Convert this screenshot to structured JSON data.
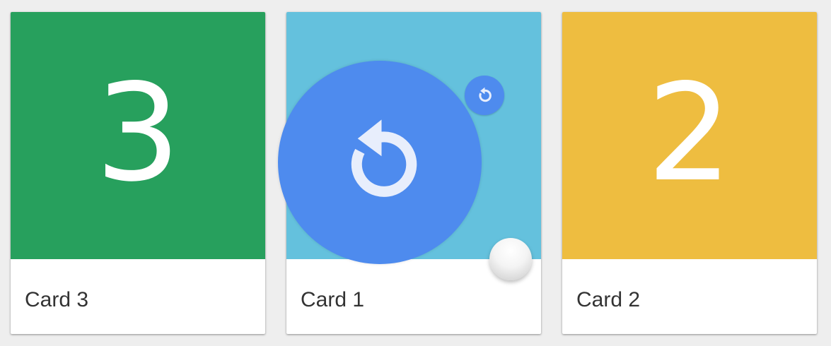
{
  "cards": [
    {
      "id": "card-3",
      "number": "3",
      "label": "Card 3",
      "color": "#27a05d"
    },
    {
      "id": "card-1",
      "number": "",
      "label": "Card 1",
      "color": "#64c1dd"
    },
    {
      "id": "card-2",
      "number": "2",
      "label": "Card 2",
      "color": "#eebd40"
    }
  ],
  "colors": {
    "background": "#eeeeee",
    "fab": "#4e8bee",
    "icon": "#e8eefc"
  },
  "icons": {
    "big_fab": "refresh-icon",
    "small_fab": "refresh-icon"
  }
}
